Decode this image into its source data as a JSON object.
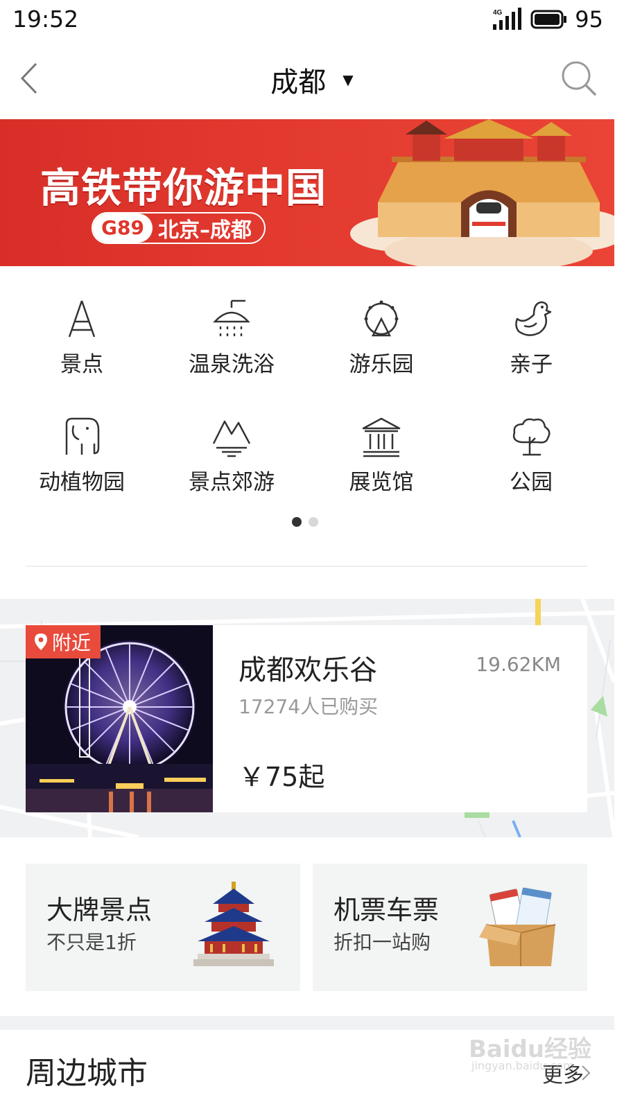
{
  "status_bar": {
    "time": "19:52",
    "network": "4G",
    "battery": "95"
  },
  "header": {
    "city": "成都",
    "caret": "▼"
  },
  "banner": {
    "headline": "高铁带你游中国",
    "train_code": "G89",
    "route": "北京–成都"
  },
  "categories": [
    {
      "label": "景点",
      "icon": "tower-icon"
    },
    {
      "label": "温泉洗浴",
      "icon": "shower-icon"
    },
    {
      "label": "游乐园",
      "icon": "ferris-wheel-icon"
    },
    {
      "label": "亲子",
      "icon": "duck-icon"
    },
    {
      "label": "动植物园",
      "icon": "elephant-icon"
    },
    {
      "label": "景点郊游",
      "icon": "mountain-icon"
    },
    {
      "label": "展览馆",
      "icon": "museum-icon"
    },
    {
      "label": "公园",
      "icon": "tree-icon"
    }
  ],
  "pager": {
    "pages": 2,
    "active": 1
  },
  "nearby": {
    "tag": "附近",
    "name": "成都欢乐谷",
    "distance": "19.62KM",
    "sold": "17274人已购买",
    "price": "￥75起"
  },
  "promos": [
    {
      "title": "大牌景点",
      "subtitle": "不只是1折",
      "icon": "temple-icon"
    },
    {
      "title": "机票车票",
      "subtitle": "折扣一站购",
      "icon": "ticket-box-icon"
    }
  ],
  "section": {
    "title": "周边城市",
    "more": "更多"
  },
  "watermark": {
    "brand": "Baidu经验",
    "url": "jingyan.baidu.com"
  },
  "colors": {
    "accent": "#e84a3c",
    "banner": "#d72f28"
  }
}
